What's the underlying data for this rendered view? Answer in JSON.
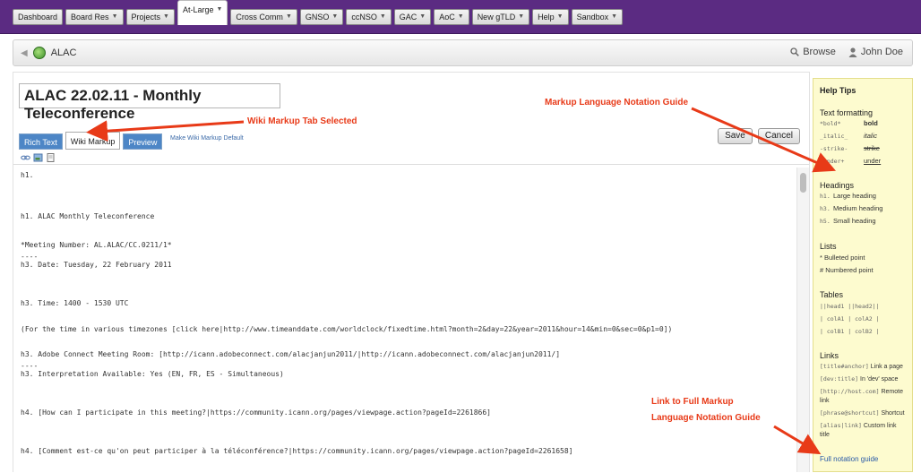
{
  "topnav": {
    "tabs": [
      {
        "label": "Dashboard",
        "caret": false
      },
      {
        "label": "Board Res",
        "caret": true
      },
      {
        "label": "Projects",
        "caret": true
      },
      {
        "label": "At-Large",
        "caret": true
      },
      {
        "label": "Cross Comm",
        "caret": true
      },
      {
        "label": "GNSO",
        "caret": true
      },
      {
        "label": "ccNSO",
        "caret": true
      },
      {
        "label": "GAC",
        "caret": true
      },
      {
        "label": "AoC",
        "caret": true
      },
      {
        "label": "New gTLD",
        "caret": true
      },
      {
        "label": "Help",
        "caret": true
      },
      {
        "label": "Sandbox",
        "caret": true
      }
    ],
    "active_tab": "At-Large"
  },
  "subbar": {
    "space": "ALAC",
    "browse": "Browse",
    "user": "John Doe"
  },
  "editor": {
    "title": "ALAC 22.02.11 - Monthly Teleconference",
    "tabs": [
      "Rich Text",
      "Wiki Markup",
      "Preview"
    ],
    "selected_tab": "Wiki Markup",
    "make_default": "Make Wiki Markup Default",
    "save": "Save",
    "cancel": "Cancel",
    "lines": [
      "h1.",
      "h1. ALAC Monthly Teleconference",
      "*Meeting Number: AL.ALAC/CC.0211/1*",
      "----",
      "h3. Date: Tuesday, 22 February 2011",
      "h3. Time: 1400 - 1530 UTC",
      "(For the time in various timezones [click here|http://www.timeanddate.com/worldclock/fixedtime.html?month=2&day=22&year=2011&hour=14&min=0&sec=0&p1=0])",
      "h3. Adobe Connect Meeting Room: [http://icann.adobeconnect.com/alacjanjun2011/|http://icann.adobeconnect.com/alacjanjun2011/]",
      "----",
      "h3. Interpretation Available: Yes (EN, FR, ES - Simultaneous)",
      "h4. [How can I participate in this meeting?|https://community.icann.org/pages/viewpage.action?pageId=2261866]",
      "h4. [Comment est-ce qu'on peut participer à la téléconférence?|https://community.icann.org/pages/viewpage.action?pageId=2261658]"
    ]
  },
  "help": {
    "title": "Help Tips",
    "text_formatting": {
      "heading": "Text formatting",
      "rows": [
        {
          "code": "*bold*",
          "label": "bold"
        },
        {
          "code": "_italic_",
          "label": "italic"
        },
        {
          "code": "-strike-",
          "label": "strike"
        },
        {
          "code": "+under+",
          "label": "under"
        }
      ]
    },
    "headings": {
      "heading": "Headings",
      "rows": [
        {
          "code": "h1.",
          "label": "Large heading"
        },
        {
          "code": "h3.",
          "label": "Medium heading"
        },
        {
          "code": "h5.",
          "label": "Small heading"
        }
      ]
    },
    "lists": {
      "heading": "Lists",
      "rows": [
        "* Bulleted point",
        "# Numbered point"
      ]
    },
    "tables": {
      "heading": "Tables",
      "rows": [
        "||head1 ||head2||",
        "| colA1 | colA2 |",
        "| colB1 | colB2 |"
      ]
    },
    "links": {
      "heading": "Links",
      "rows": [
        {
          "code": "[title#anchor]",
          "label": "Link a page"
        },
        {
          "code": "[dev:title]",
          "label": "In 'dev' space"
        },
        {
          "code": "[http://host.com]",
          "label": "Remote link"
        },
        {
          "code": "[phrase@shortcut]",
          "label": "Shortcut"
        },
        {
          "code": "[alias|link]",
          "label": "Custom link title"
        }
      ]
    },
    "full_guide": "Full notation guide"
  },
  "annotations": {
    "wiki_tab": "Wiki Markup Tab Selected",
    "markup_guide": "Markup Language Notation Guide",
    "link_guide_1": "Link to Full Markup",
    "link_guide_2": "Language Notation Guide"
  },
  "colors": {
    "nav": "#5b2b82",
    "tab_blue": "#4d86c6",
    "help_bg": "#fdfbcf",
    "annotation": "#e83a18"
  }
}
